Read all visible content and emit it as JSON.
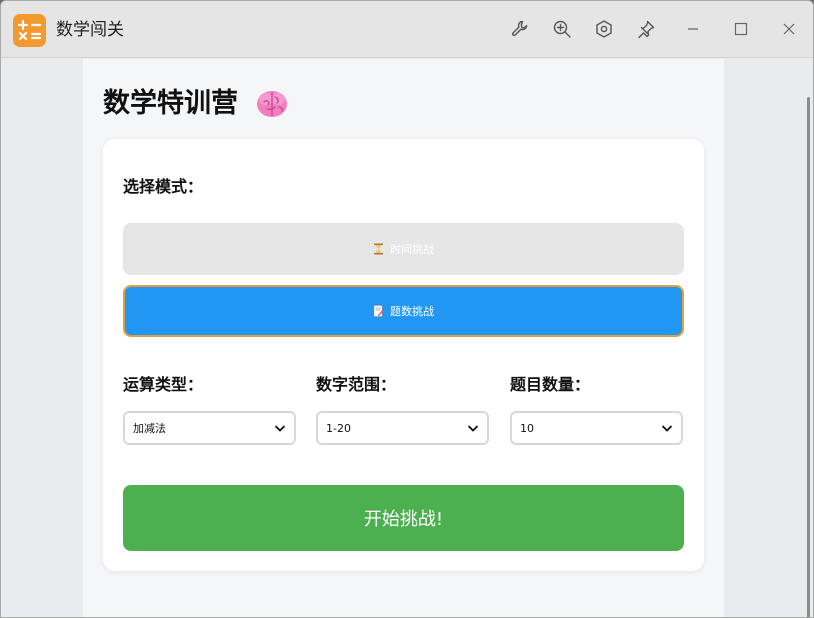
{
  "window": {
    "title": "数学闯关",
    "app_icon": "calculator-icon",
    "accent": "#f29a2f",
    "toolbar_icons": [
      "wrench-icon",
      "zoom-in-icon",
      "settings-icon",
      "pin-icon"
    ],
    "controls": [
      "minimize-icon",
      "maximize-icon",
      "close-icon"
    ]
  },
  "page": {
    "title": "数学特训营",
    "title_icon": "brain-icon"
  },
  "mode": {
    "label": "选择模式：",
    "options": [
      {
        "label": "时间挑战",
        "icon": "hourglass-icon",
        "selected": false
      },
      {
        "label": "题数挑战",
        "icon": "memo-icon",
        "selected": true
      }
    ]
  },
  "settings": {
    "operation": {
      "label": "运算类型：",
      "value": "加减法"
    },
    "range": {
      "label": "数字范围：",
      "value": "1-20"
    },
    "count": {
      "label": "题目数量：",
      "value": "10"
    }
  },
  "start_button": {
    "label": "开始挑战!",
    "color": "#4caf50"
  },
  "colors": {
    "selected_mode": "#2196f3",
    "selected_border": "#e0a13a",
    "unselected_mode": "#e6e6e6"
  }
}
